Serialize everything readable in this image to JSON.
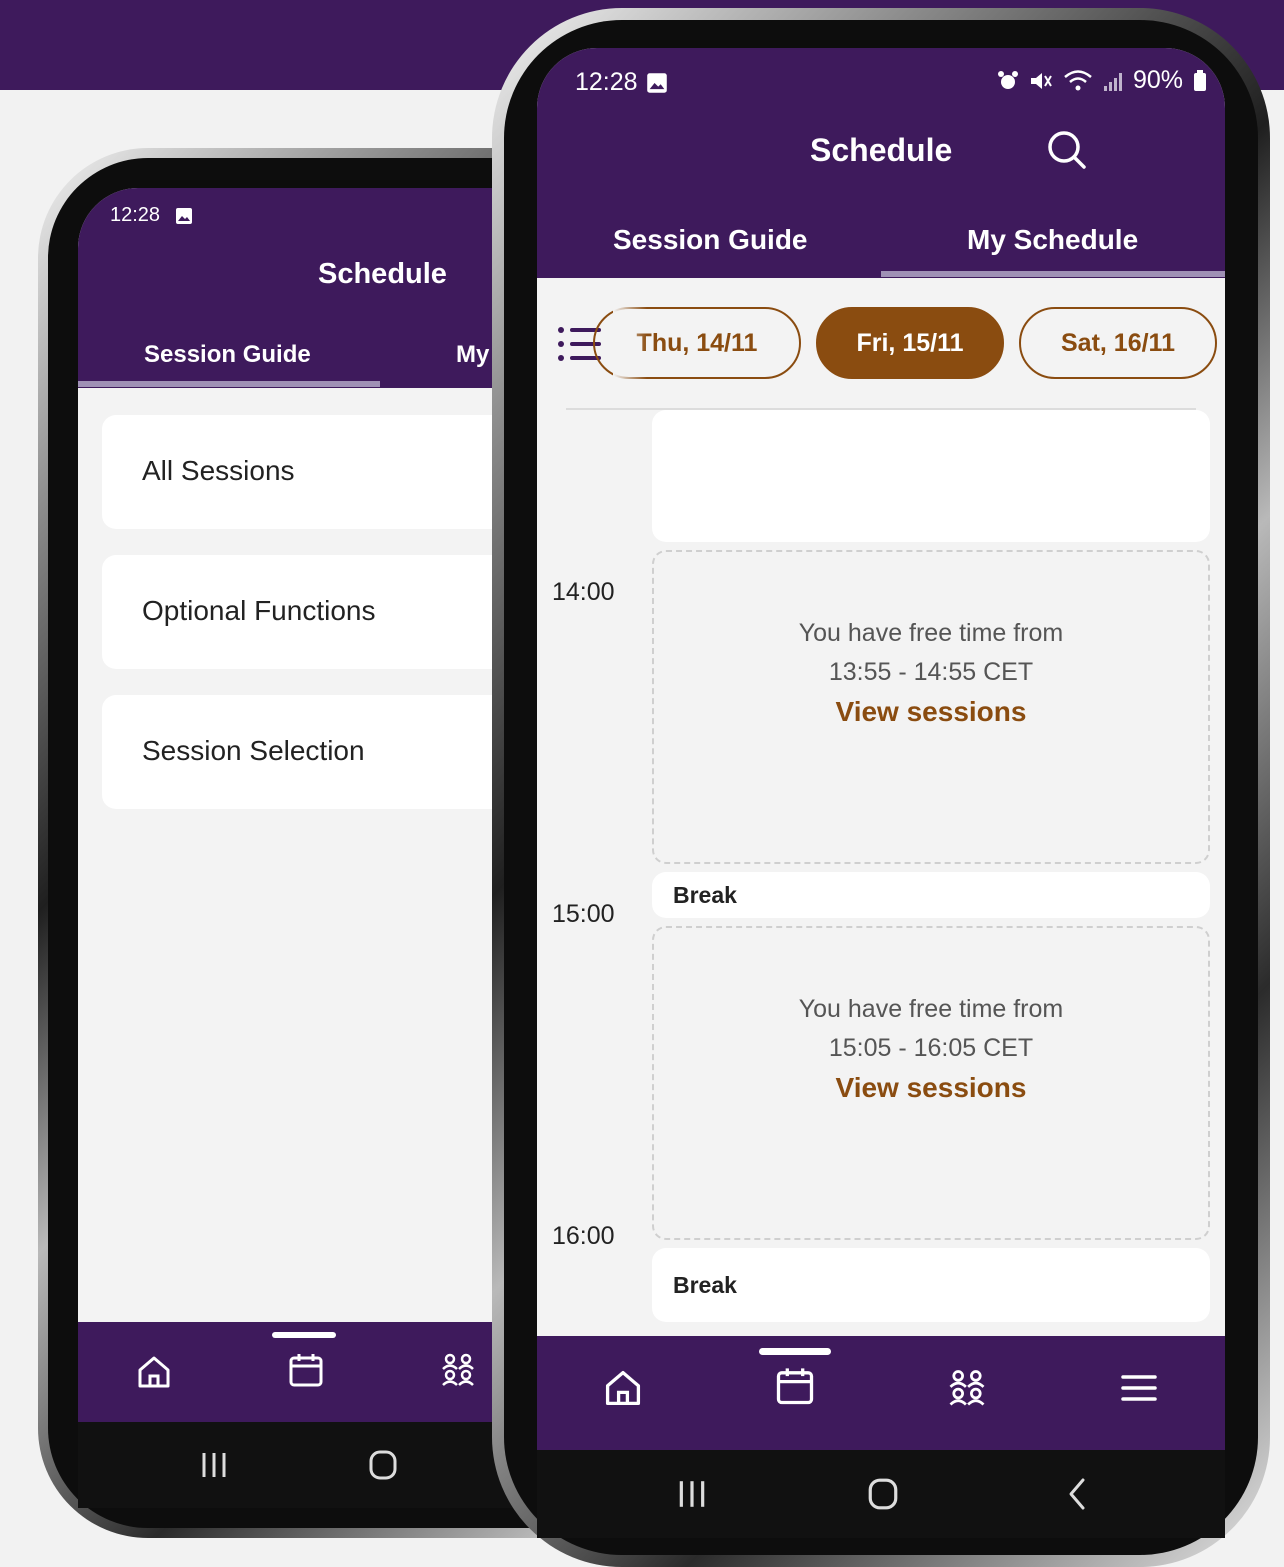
{
  "back_phone": {
    "status_time": "12:28",
    "header_title": "Schedule",
    "tabs": [
      "Session Guide",
      "My"
    ],
    "menu_items": [
      "All Sessions",
      "Optional Functions",
      "Session Selection"
    ]
  },
  "front_phone": {
    "status_time": "12:28",
    "battery": "90%",
    "header_title": "Schedule",
    "tabs": [
      "Session Guide",
      "My Schedule"
    ],
    "active_tab": "My Schedule",
    "dates": [
      "Thu, 14/11",
      "Fri, 15/11",
      "Sat, 16/11"
    ],
    "selected_date": "Fri, 15/11",
    "times": [
      "14:00",
      "15:00",
      "16:00"
    ],
    "free_blocks": [
      {
        "line1": "You have free time from",
        "line2": "13:55 - 14:55 CET",
        "link": "View sessions"
      },
      {
        "line1": "You have free time from",
        "line2": "15:05 - 16:05 CET",
        "link": "View sessions"
      }
    ],
    "breaks": [
      "Break",
      "Break"
    ],
    "bottom_nav": [
      "home-icon",
      "calendar-icon",
      "people-icon",
      "menu-icon"
    ]
  },
  "colors": {
    "brand_purple": "#3e1a5c",
    "accent_brown": "#8a4c10",
    "tab_indicator": "#9f91b5"
  }
}
